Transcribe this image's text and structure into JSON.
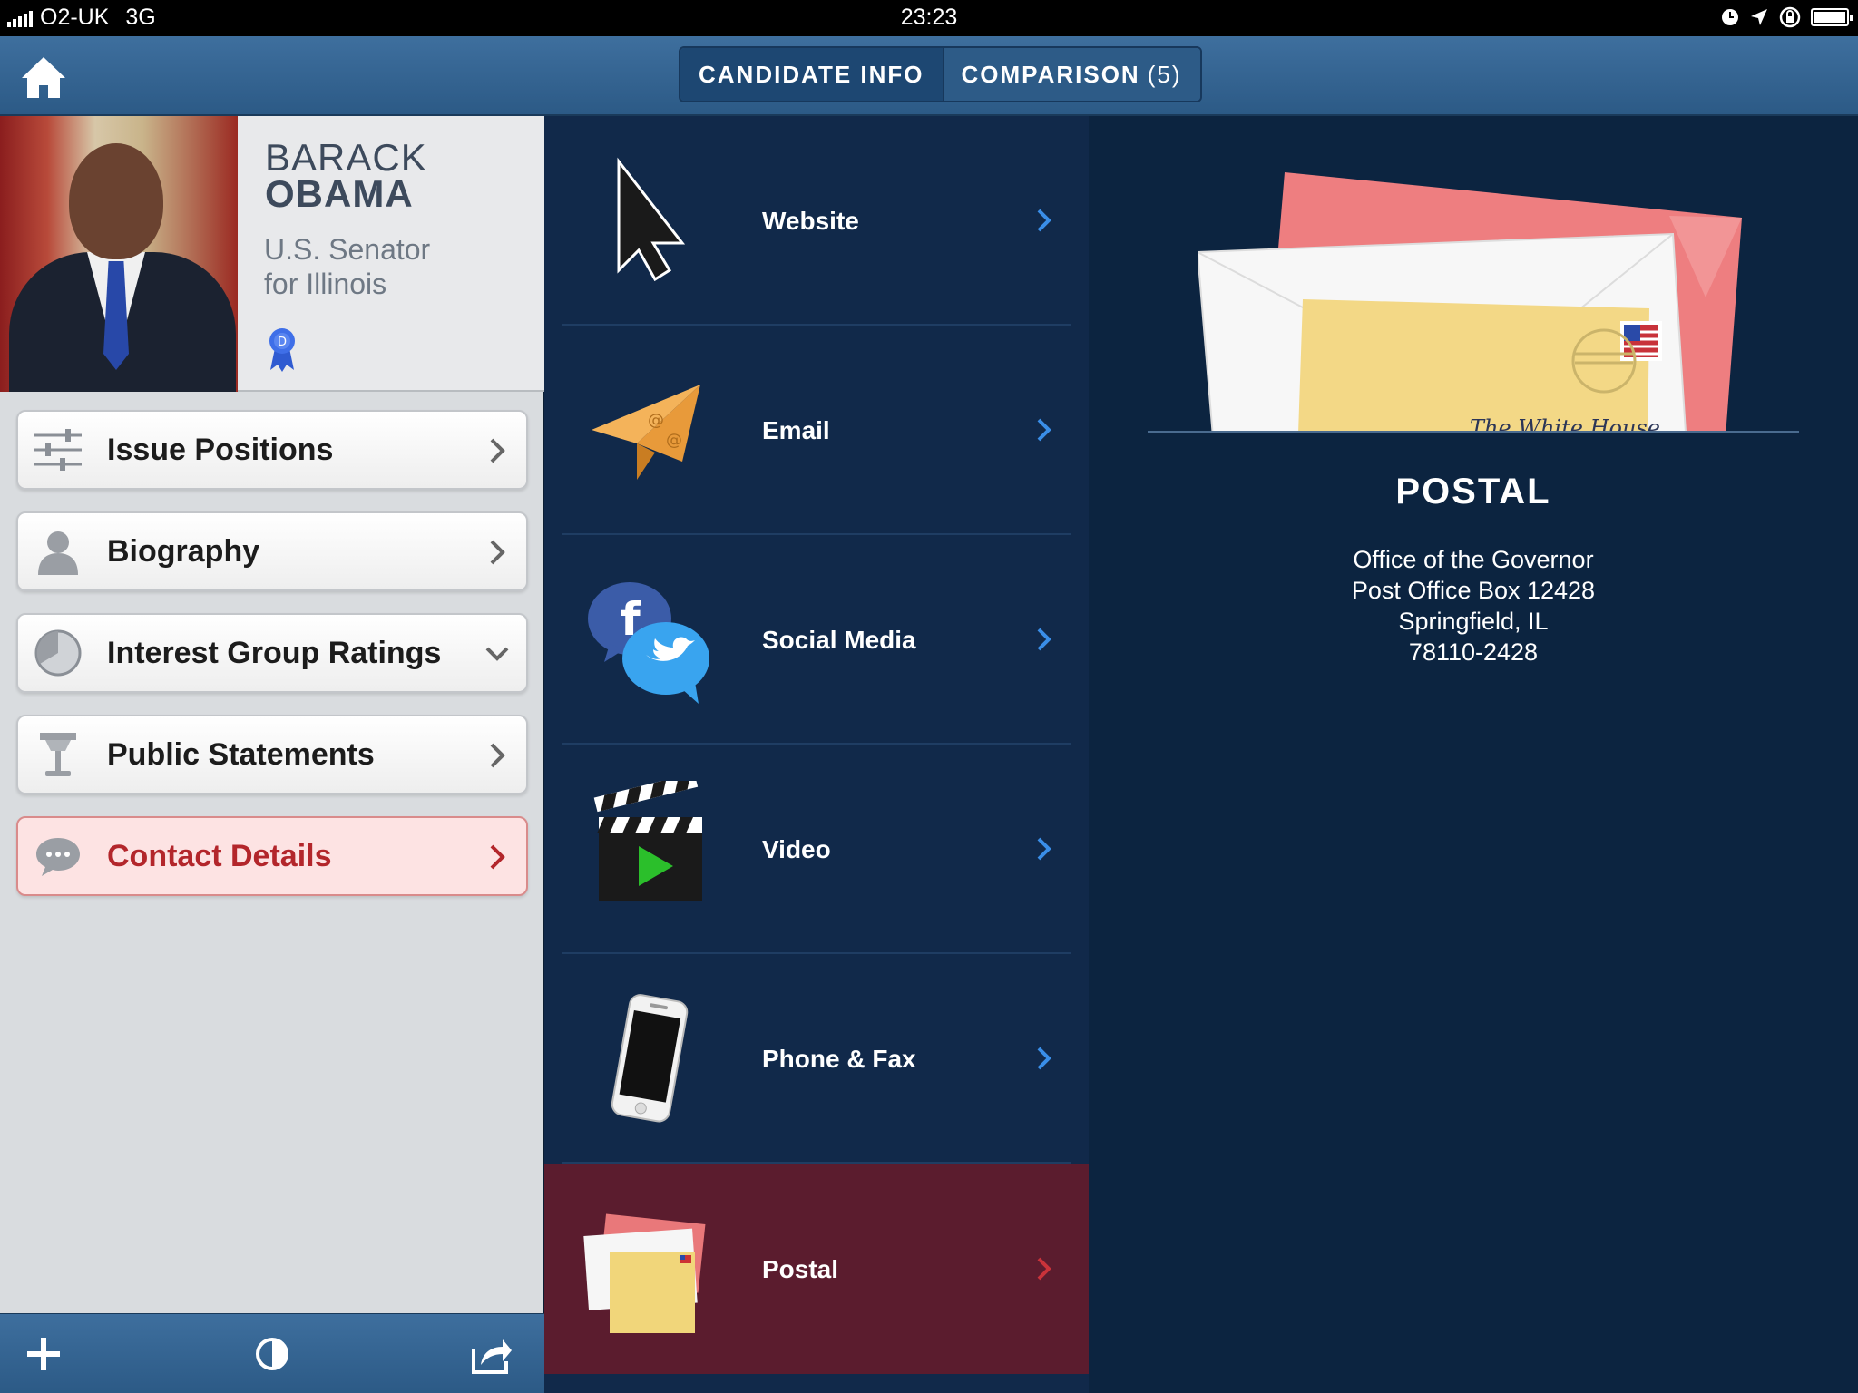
{
  "status_bar": {
    "carrier": "O2-UK",
    "network": "3G",
    "time": "23:23"
  },
  "nav": {
    "tabs": [
      {
        "label": "CANDIDATE INFO",
        "active": true
      },
      {
        "label": "COMPARISON",
        "count": "(5)",
        "active": false
      }
    ]
  },
  "profile": {
    "first_name": "BARACK",
    "last_name": "OBAMA",
    "office_line1": "U.S. Senator",
    "office_line2": "for Illinois",
    "party_badge": "D"
  },
  "menu": {
    "items": [
      {
        "label": "Issue Positions",
        "icon": "sliders-icon"
      },
      {
        "label": "Biography",
        "icon": "person-icon"
      },
      {
        "label": "Interest Group Ratings",
        "icon": "pie-chart-icon"
      },
      {
        "label": "Public Statements",
        "icon": "podium-icon"
      },
      {
        "label": "Contact Details",
        "icon": "speech-bubble-icon",
        "active": true
      }
    ]
  },
  "contact": {
    "items": [
      {
        "label": "Website",
        "icon": "cursor-icon"
      },
      {
        "label": "Email",
        "icon": "paper-plane-icon"
      },
      {
        "label": "Social Media",
        "icon": "social-bubbles-icon"
      },
      {
        "label": "Video",
        "icon": "clapperboard-icon"
      },
      {
        "label": "Phone & Fax",
        "icon": "phone-icon"
      },
      {
        "label": "Postal",
        "icon": "envelope-icon",
        "selected": true
      }
    ]
  },
  "detail": {
    "title": "POSTAL",
    "address": [
      "Office of the Governor",
      "Post Office Box 12428",
      "Springfield, IL",
      "78110-2428"
    ],
    "envelope_text": "The White House"
  },
  "colors": {
    "nav_blue": "#2c5a86",
    "active_accent": "#b3262b",
    "selected_row": "#5b1c2e",
    "panel_dark": "#11294a"
  }
}
